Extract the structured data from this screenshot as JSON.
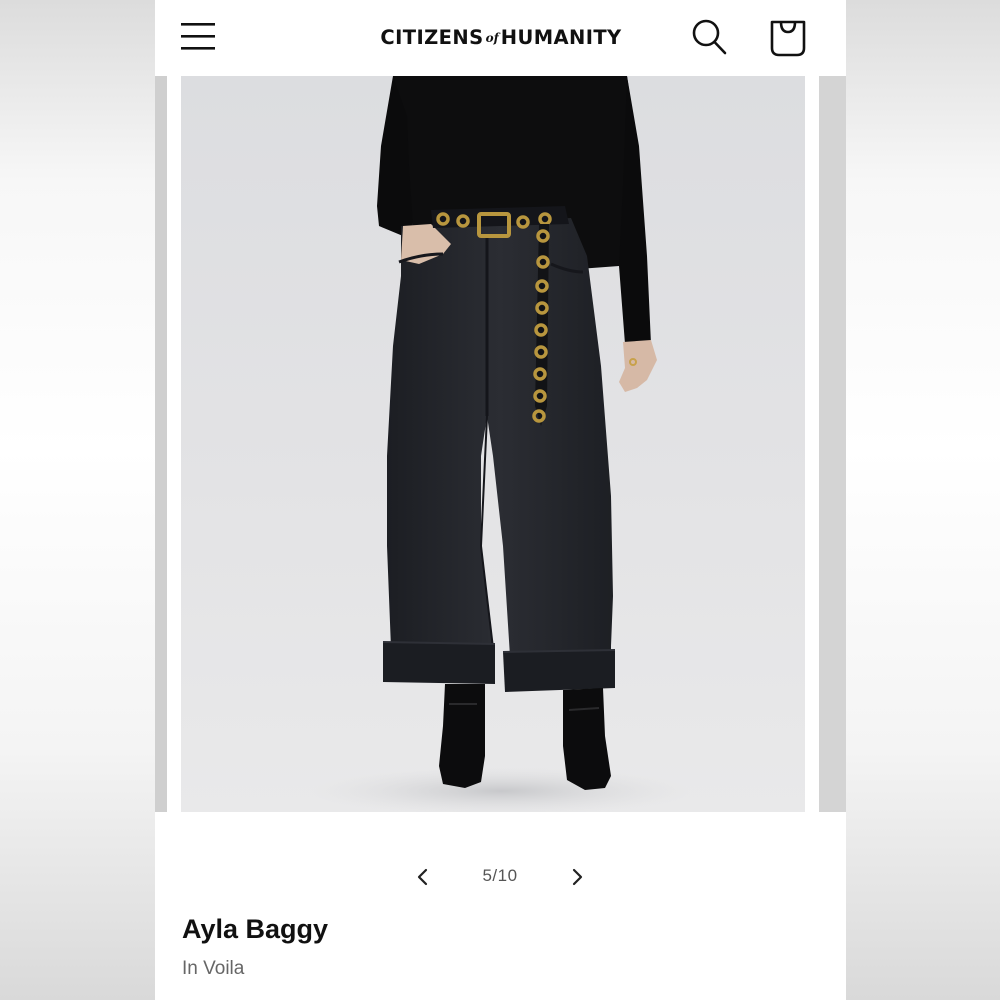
{
  "header": {
    "brand_left": "CITIZENS",
    "brand_of": "of",
    "brand_right": "HUMANITY",
    "menu_icon": "hamburger-menu-icon",
    "search_icon": "search-icon",
    "bag_icon": "shopping-bag-icon"
  },
  "carousel": {
    "image_subject": "model wearing black wide-leg cuffed jeans with grommet belt, black top and black ankle boots",
    "counter": "5/10",
    "current": 5,
    "total": 10,
    "prev_icon": "chevron-left-icon",
    "next_icon": "chevron-right-icon"
  },
  "product": {
    "name": "Ayla Baggy",
    "color": "In Voila"
  },
  "colors": {
    "text": "#111111",
    "muted": "#666666",
    "background": "#ffffff",
    "denim": "#23252b"
  }
}
